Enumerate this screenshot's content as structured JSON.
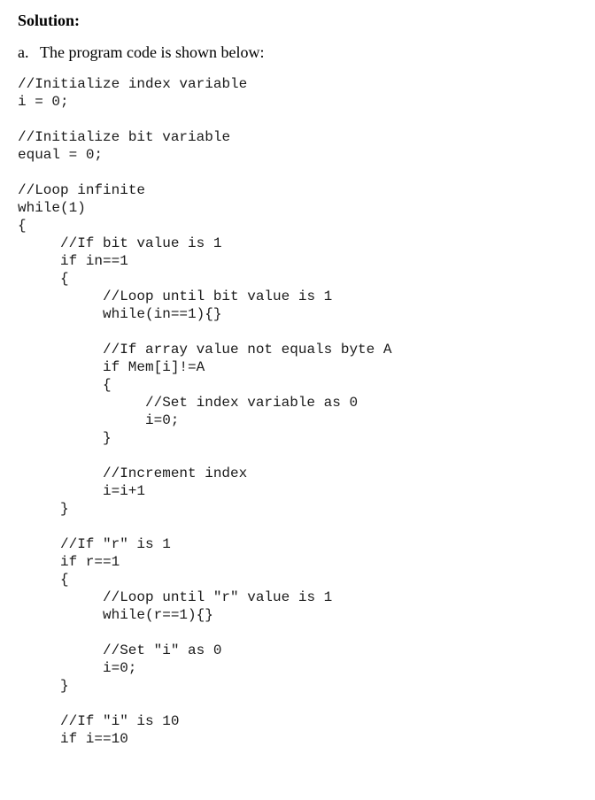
{
  "heading": "Solution:",
  "intro": {
    "marker": "a.",
    "text": "The program code is shown below:"
  },
  "code_lines": [
    {
      "indent": 0,
      "text": "//Initialize index variable"
    },
    {
      "indent": 0,
      "text": "i = 0;"
    },
    {
      "indent": 0,
      "text": ""
    },
    {
      "indent": 0,
      "text": "//Initialize bit variable"
    },
    {
      "indent": 0,
      "text": "equal = 0;"
    },
    {
      "indent": 0,
      "text": ""
    },
    {
      "indent": 0,
      "text": "//Loop infinite"
    },
    {
      "indent": 0,
      "text": "while(1)"
    },
    {
      "indent": 0,
      "text": "{"
    },
    {
      "indent": 1,
      "text": "//If bit value is 1"
    },
    {
      "indent": 1,
      "text": "if in==1"
    },
    {
      "indent": 1,
      "text": "{"
    },
    {
      "indent": 2,
      "text": "//Loop until bit value is 1"
    },
    {
      "indent": 2,
      "text": "while(in==1){}"
    },
    {
      "indent": 0,
      "text": ""
    },
    {
      "indent": 2,
      "text": "//If array value not equals byte A"
    },
    {
      "indent": 2,
      "text": "if Mem[i]!=A"
    },
    {
      "indent": 2,
      "text": "{"
    },
    {
      "indent": 3,
      "text": "//Set index variable as 0"
    },
    {
      "indent": 3,
      "text": "i=0;"
    },
    {
      "indent": 2,
      "text": "}"
    },
    {
      "indent": 0,
      "text": ""
    },
    {
      "indent": 2,
      "text": "//Increment index"
    },
    {
      "indent": 2,
      "text": "i=i+1"
    },
    {
      "indent": 1,
      "text": "}"
    },
    {
      "indent": 0,
      "text": ""
    },
    {
      "indent": 1,
      "text": "//If \"r\" is 1"
    },
    {
      "indent": 1,
      "text": "if r==1"
    },
    {
      "indent": 1,
      "text": "{"
    },
    {
      "indent": 2,
      "text": "//Loop until \"r\" value is 1"
    },
    {
      "indent": 2,
      "text": "while(r==1){}"
    },
    {
      "indent": 0,
      "text": ""
    },
    {
      "indent": 2,
      "text": "//Set \"i\" as 0"
    },
    {
      "indent": 2,
      "text": "i=0;"
    },
    {
      "indent": 1,
      "text": "}"
    },
    {
      "indent": 0,
      "text": ""
    },
    {
      "indent": 1,
      "text": "//If \"i\" is 10"
    },
    {
      "indent": 1,
      "text": "if i==10"
    }
  ]
}
